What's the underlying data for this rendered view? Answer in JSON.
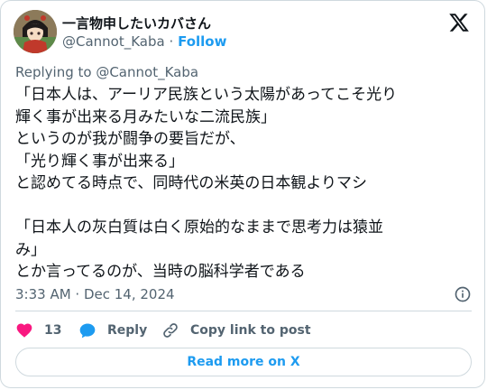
{
  "author": {
    "display_name": "一言物申したいカバさん",
    "handle": "@Cannot_Kaba",
    "separator": "·",
    "follow_label": "Follow",
    "avatar_icon": "anime-character-avatar"
  },
  "reply_context": {
    "text": "Replying to @Cannot_Kaba"
  },
  "tweet": {
    "lines": [
      "「日本人は、アーリア民族という太陽があってこそ光り",
      "輝く事が出来る月みたいな二流民族」",
      "というのが我が闘争の要旨だが、",
      "「光り輝く事が出来る」",
      "と認めてる時点で、同時代の米英の日本観よりマシ",
      "",
      "「日本人の灰白質は白く原始的なままで思考力は猿並",
      "み」",
      "とか言ってるのが、当時の脳科学者である"
    ],
    "timestamp": "3:33 AM · Dec 14, 2024"
  },
  "actions": {
    "like_count": "13",
    "reply_label": "Reply",
    "copy_link_label": "Copy link to post"
  },
  "footer": {
    "read_more_label": "Read more on X"
  },
  "colors": {
    "accent": "#1d9bf0",
    "like": "#f91880",
    "text_secondary": "#536471",
    "border": "#cfd9de"
  }
}
